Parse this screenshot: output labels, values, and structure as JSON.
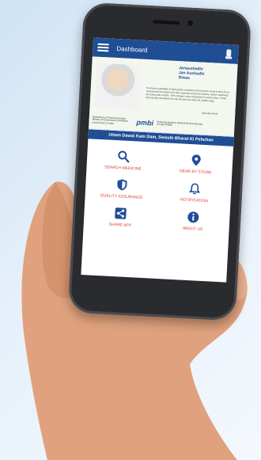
{
  "app": {
    "title": "Dashboard"
  },
  "banner": {
    "logo_text": "Janaushadhi Jan Aushadhi Diwas",
    "quote": "To ensure availability of high quality medicines at low prices, three-tenths of our Janaushadhi Kendras have been opened across the country, where medicines are being sold at 50% - 90% cheaper rates compared to market rates. These have greatly benefited not only the poor but also the middle class.",
    "signature": "Narendra Modi",
    "org1": "Department of Pharmaceuticals Ministry of Chemicals & Fertilizers Government of India",
    "pmbi": "pmbi",
    "org2": "Pharmaceuticals & Medical Devices Bureau of India (PMBI)"
  },
  "tagline": "Uttam Dawai Kam Dam, Swasth Bharat Ki Pehchan",
  "tiles": [
    {
      "label": "SEARCH MEDICINE",
      "icon": "search-icon"
    },
    {
      "label": "NEAR BY STORE",
      "icon": "location-pin-icon"
    },
    {
      "label": "QUALITY ASSURANCE",
      "icon": "shield-icon"
    },
    {
      "label": "NOTIFICATION",
      "icon": "bell-icon"
    },
    {
      "label": "SHARE APP",
      "icon": "share-icon"
    },
    {
      "label": "ABOUT US",
      "icon": "info-icon"
    }
  ],
  "colors": {
    "primary": "#1f4e95",
    "accent": "#e03a2f"
  }
}
